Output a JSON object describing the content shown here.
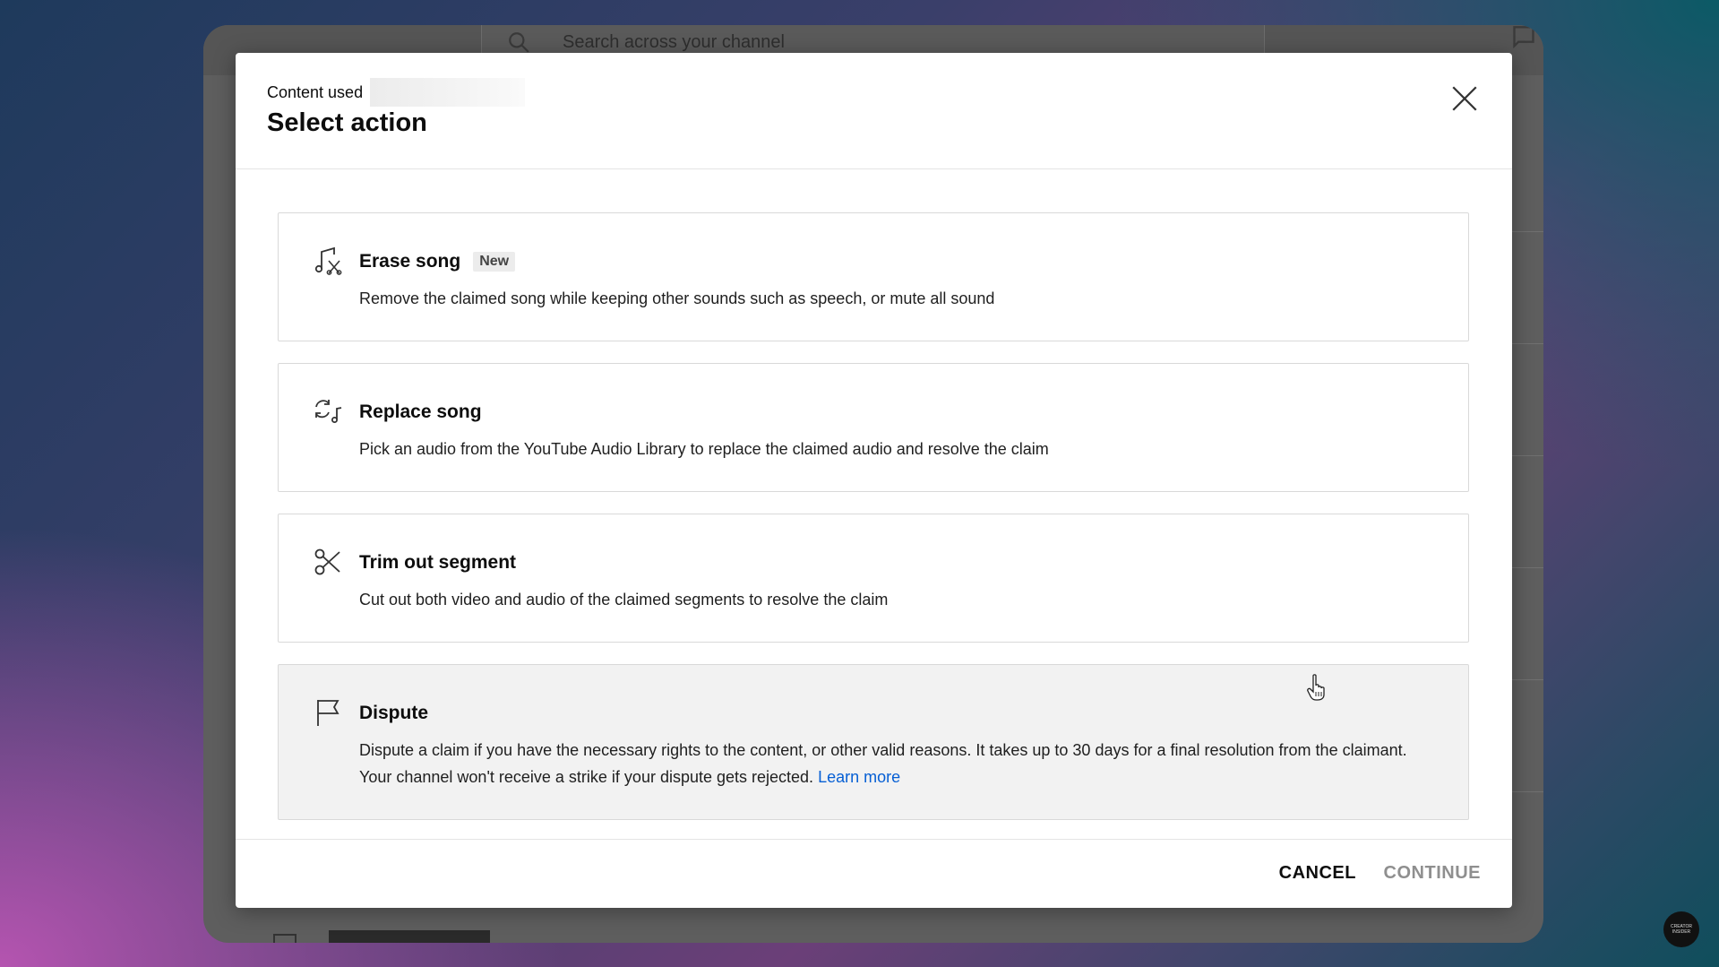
{
  "background_app": {
    "search_placeholder": "Search across your channel"
  },
  "dialog": {
    "content_used_label": "Content used",
    "title": "Select action",
    "close_icon": "close-icon",
    "options": [
      {
        "title": "Erase song",
        "badge": "New",
        "description": "Remove the claimed song while keeping other sounds such as speech, or mute all sound",
        "icon": "erase-song-icon"
      },
      {
        "title": "Replace song",
        "description": "Pick an audio from the YouTube Audio Library to replace the claimed audio and resolve the claim",
        "icon": "replace-song-icon"
      },
      {
        "title": "Trim out segment",
        "description": "Cut out both video and audio of the claimed segments to resolve the claim",
        "icon": "scissors-icon"
      },
      {
        "title": "Dispute",
        "description": "Dispute a claim if you have the necessary rights to the content, or other valid reasons. It takes up to 30 days for a final resolution from the claimant. Your channel won't receive a strike if your dispute gets rejected.",
        "link": "Learn more",
        "icon": "flag-icon"
      }
    ],
    "footer": {
      "cancel_label": "CANCEL",
      "continue_label": "CONTINUE"
    }
  },
  "watermark": {
    "line1": "CREATOR",
    "line2": "INSIDER"
  },
  "colors": {
    "link": "#065fd4",
    "continue_disabled": "#8f8f8f",
    "selected_option_bg": "#f2f2f2"
  }
}
